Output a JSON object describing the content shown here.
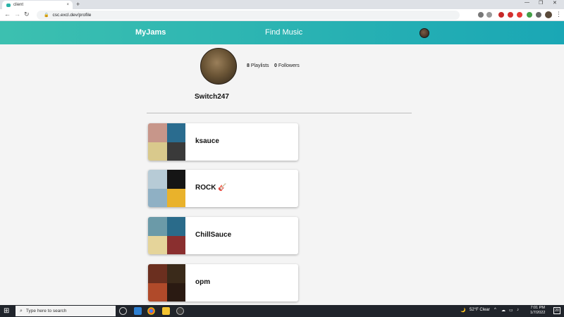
{
  "browser": {
    "tab_title": "client",
    "tab_close": "×",
    "new_tab": "+",
    "url": "csc.excl.dev/profile",
    "window_min": "—",
    "window_max": "❐",
    "window_close": "✕",
    "back": "←",
    "forward": "→",
    "reload": "↻",
    "lock": "🔒",
    "kebab": "⋮"
  },
  "header": {
    "brand": "MyJams",
    "nav_find": "Find Music"
  },
  "profile": {
    "playlists_count": "8",
    "playlists_label": "Playlists",
    "followers_count": "0",
    "followers_label": "Followers",
    "username": "Switch247"
  },
  "playlists": [
    {
      "title": "ksauce",
      "colors": [
        "#c7968a",
        "#2a6c8f",
        "#d9c98c",
        "#3a3a3a"
      ]
    },
    {
      "title": "ROCK 🎸",
      "colors": [
        "#b7cbd6",
        "#151515",
        "#8fb0c4",
        "#e9b22b"
      ]
    },
    {
      "title": "ChillSauce",
      "colors": [
        "#6b9aa8",
        "#2a6b8a",
        "#e5d49a",
        "#8a2f2f"
      ]
    },
    {
      "title": "opm",
      "colors": [
        "#6b2f1f",
        "#3a2a1a",
        "#b04a2a",
        "#2a1a12"
      ]
    }
  ],
  "taskbar": {
    "start": "⊞",
    "search_placeholder": "Type here to search",
    "search_icon": "⌕",
    "weather": "52°F  Clear",
    "time": "7:01 PM",
    "date": "1/7/2022",
    "notif": "20"
  },
  "colors": {
    "header_start": "#3cc0b0",
    "header_end": "#1aa7b5",
    "taskbar": "#20242b"
  }
}
